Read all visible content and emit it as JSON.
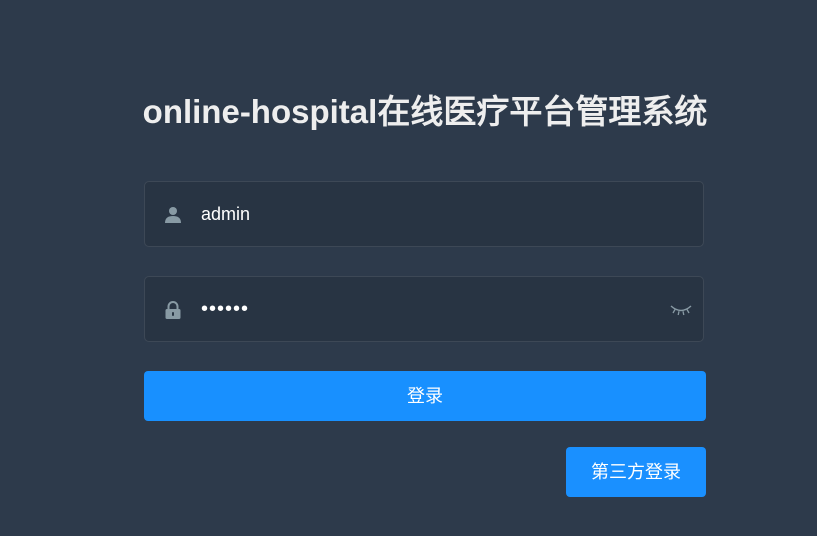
{
  "login": {
    "title": "online-hospital在线医疗平台管理系统",
    "username": {
      "value": "admin",
      "icon": "user-icon"
    },
    "password": {
      "value": "123456",
      "icon": "lock-icon",
      "toggle_icon": "eye-closed-icon"
    },
    "login_button": "登录",
    "third_party_button": "第三方登录"
  },
  "colors": {
    "background": "#2d3a4b",
    "input_background": "#283443",
    "primary": "#1890ff",
    "icon": "#889aa4",
    "title": "#eeeeee"
  }
}
